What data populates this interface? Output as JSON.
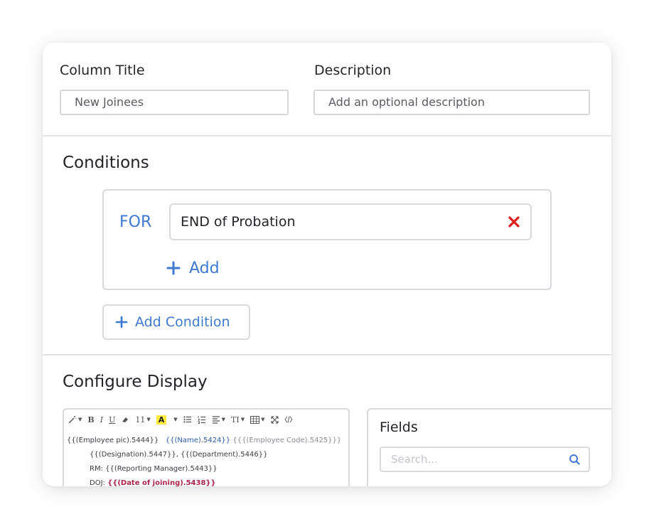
{
  "form": {
    "column_title_label": "Column Title",
    "column_title_value": "New Joinees",
    "description_label": "Description",
    "description_placeholder": "Add an optional description"
  },
  "conditions": {
    "title": "Conditions",
    "for_label": "FOR",
    "condition_value": "END of Probation",
    "add_label": "Add",
    "add_condition_label": "Add Condition"
  },
  "display": {
    "title": "Configure Display",
    "toolbar": {
      "font_size": "11",
      "highlight": "A",
      "text_style": "TI"
    },
    "editor_lines": {
      "l1_a": "{{(Employee pic).5444}}",
      "l1_b": "{{(Name).5424}}",
      "l1_c": "{{{(Employee Code).5425}}}",
      "l2": "{{(Designation).5447}}, {{(Department).5446}}",
      "l3": "RM: {{(Reporting Manager).5443}}",
      "l4_a": "DOJ: ",
      "l4_b": "{{(Date of joining).5438}}"
    },
    "fields_title": "Fields",
    "search_placeholder": "Search..."
  },
  "colors": {
    "accent": "#3e7ad3",
    "danger": "#e01e1e",
    "border": "#d8dadd"
  },
  "icons": [
    "close-icon",
    "plus-icon",
    "search-icon",
    "magic-wand-icon",
    "eraser-icon",
    "list-icon",
    "table-icon",
    "fullscreen-icon",
    "code-icon"
  ]
}
